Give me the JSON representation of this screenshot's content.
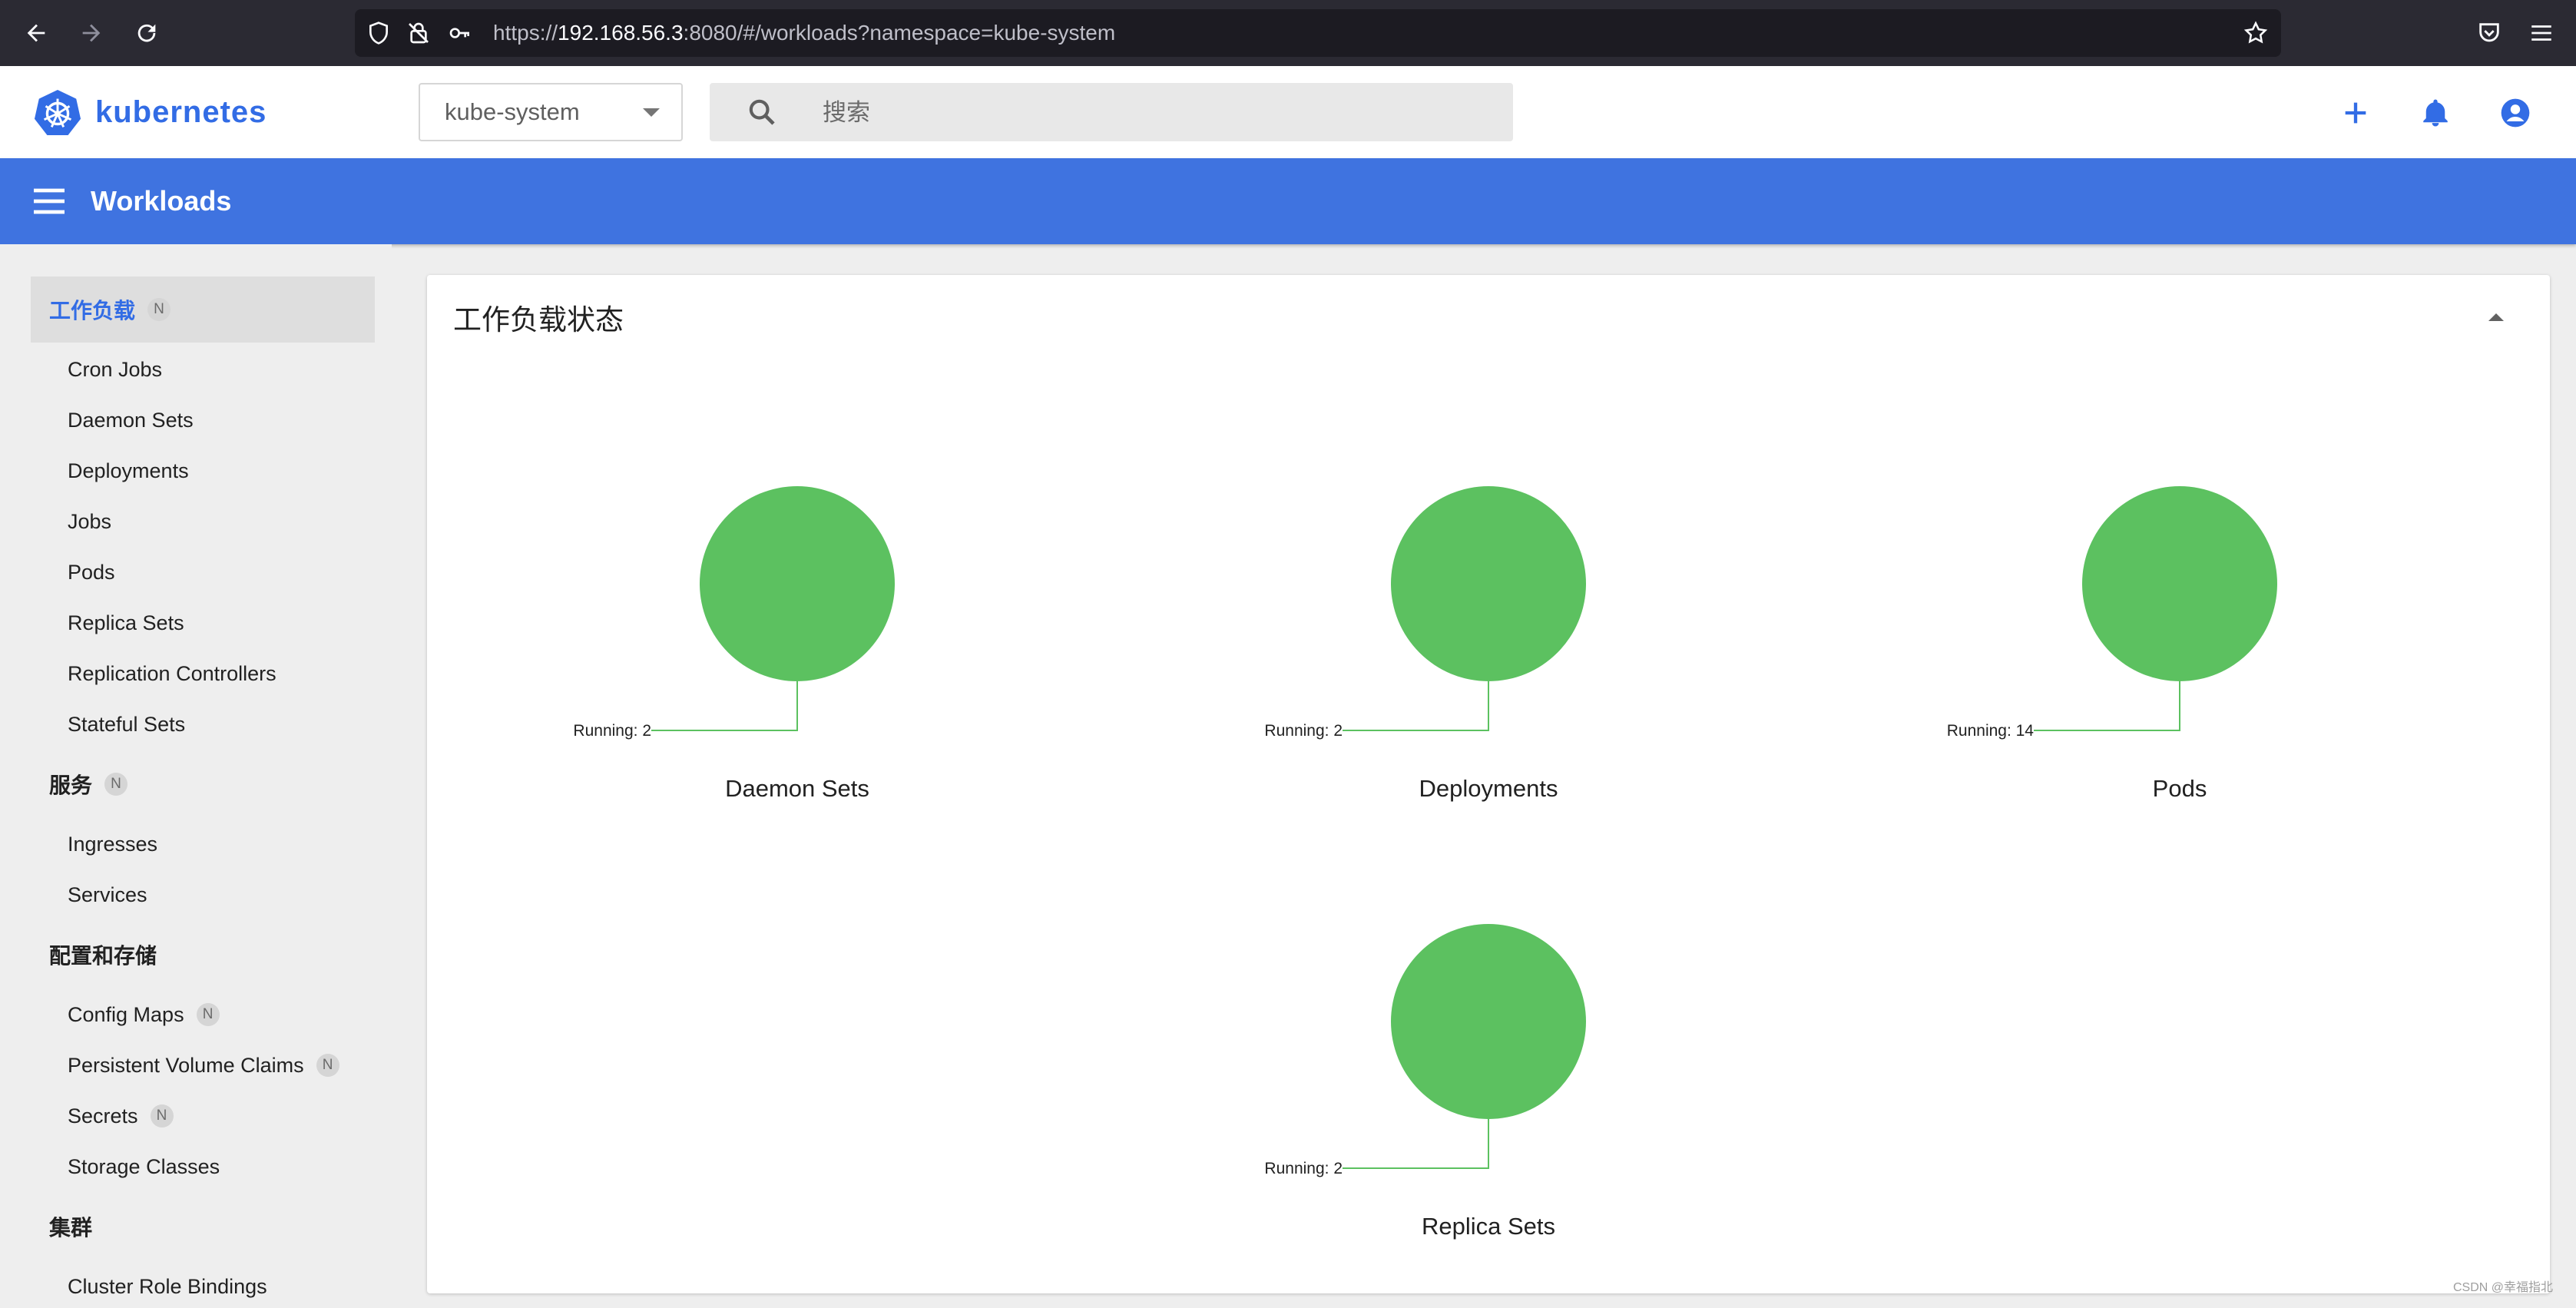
{
  "browser": {
    "url_prefix": "https://",
    "url_host": "192.168.56.3",
    "url_rest": ":8080/#/workloads?namespace=kube-system"
  },
  "header": {
    "logo_text": "kubernetes",
    "namespace": "kube-system",
    "search_placeholder": "搜索"
  },
  "toolbar": {
    "title": "Workloads"
  },
  "sidebar": {
    "groups": [
      {
        "label": "工作负载",
        "badge": "N",
        "items": [
          "Cron Jobs",
          "Daemon Sets",
          "Deployments",
          "Jobs",
          "Pods",
          "Replica Sets",
          "Replication Controllers",
          "Stateful Sets"
        ]
      },
      {
        "label": "服务",
        "badge": "N",
        "items": [
          "Ingresses",
          "Services"
        ]
      },
      {
        "label": "配置和存储",
        "badge": "",
        "items": [
          {
            "label": "Config Maps",
            "badge": "N"
          },
          {
            "label": "Persistent Volume Claims",
            "badge": "N"
          },
          {
            "label": "Secrets",
            "badge": "N"
          },
          {
            "label": "Storage Classes",
            "badge": ""
          }
        ]
      },
      {
        "label": "集群",
        "badge": "",
        "items": [
          "Cluster Role Bindings"
        ]
      }
    ]
  },
  "card": {
    "title": "工作负载状态"
  },
  "chart_data": [
    {
      "type": "pie",
      "title": "Daemon Sets",
      "slices": [
        {
          "label": "Running",
          "value": 2,
          "color": "#5cc160"
        }
      ]
    },
    {
      "type": "pie",
      "title": "Deployments",
      "slices": [
        {
          "label": "Running",
          "value": 2,
          "color": "#5cc160"
        }
      ]
    },
    {
      "type": "pie",
      "title": "Pods",
      "slices": [
        {
          "label": "Running",
          "value": 14,
          "color": "#5cc160"
        }
      ]
    },
    {
      "type": "pie",
      "title": "Replica Sets",
      "slices": [
        {
          "label": "Running",
          "value": 2,
          "color": "#5cc160"
        }
      ]
    }
  ],
  "watermark": "CSDN @幸福指北",
  "colors": {
    "brand": "#326ce5",
    "toolbar": "#3f73e0",
    "running": "#5cc160"
  }
}
